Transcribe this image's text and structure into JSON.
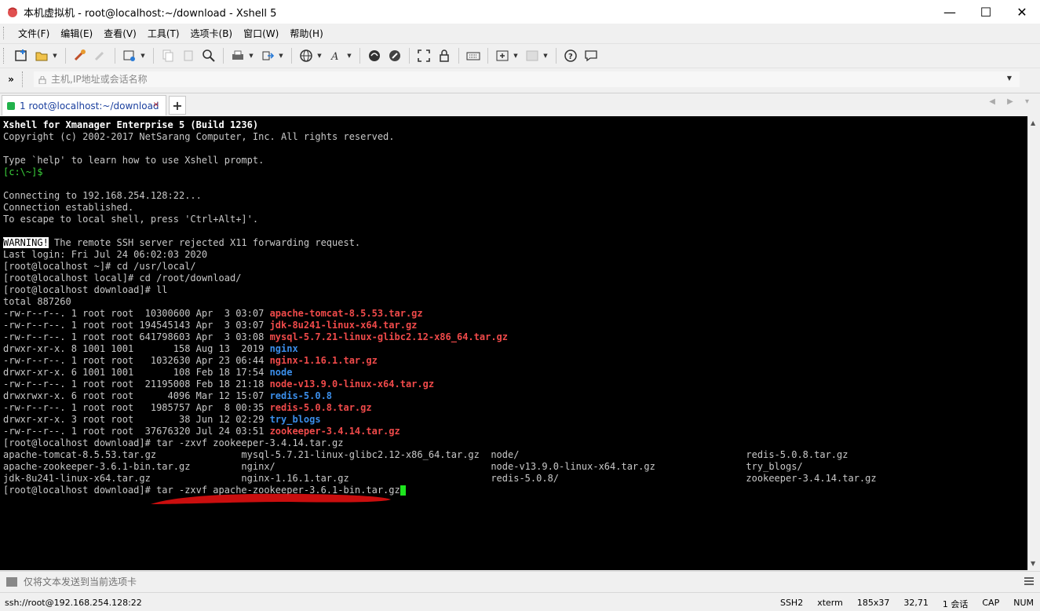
{
  "window": {
    "title": "本机虚拟机 - root@localhost:~/download - Xshell 5",
    "minimize": "—",
    "maximize": "☐",
    "close": "✕"
  },
  "menu": [
    "文件(F)",
    "编辑(E)",
    "查看(V)",
    "工具(T)",
    "选项卡(B)",
    "窗口(W)",
    "帮助(H)"
  ],
  "address": {
    "chevron": "»",
    "placeholder": "主机,IP地址或会话名称"
  },
  "tabs": {
    "active_label": "1 root@localhost:~/download",
    "close": "×",
    "add": "+",
    "nav": "◀ ▶ ▾"
  },
  "terminal": {
    "lines": [
      [
        {
          "t": "Xshell for Xmanager Enterprise 5 (Build 1236)",
          "c": "bold"
        }
      ],
      [
        {
          "t": "Copyright (c) 2002-2017 NetSarang Computer, Inc. All rights reserved.",
          "c": ""
        }
      ],
      [
        {
          "t": "",
          "c": ""
        }
      ],
      [
        {
          "t": "Type `help' to learn how to use Xshell prompt.",
          "c": ""
        }
      ],
      [
        {
          "t": "[c:\\~]$",
          "c": "green"
        }
      ],
      [
        {
          "t": "",
          "c": ""
        }
      ],
      [
        {
          "t": "Connecting to 192.168.254.128:22...",
          "c": ""
        }
      ],
      [
        {
          "t": "Connection established.",
          "c": ""
        }
      ],
      [
        {
          "t": "To escape to local shell, press 'Ctrl+Alt+]'.",
          "c": ""
        }
      ],
      [
        {
          "t": "",
          "c": ""
        }
      ],
      [
        {
          "t": "WARNING!",
          "c": "warn"
        },
        {
          "t": " The remote SSH server rejected X11 forwarding request.",
          "c": ""
        }
      ],
      [
        {
          "t": "Last login: Fri Jul 24 06:02:03 2020",
          "c": ""
        }
      ],
      [
        {
          "t": "[root@localhost ~]# cd /usr/local/",
          "c": ""
        }
      ],
      [
        {
          "t": "[root@localhost local]# cd /root/download/",
          "c": ""
        }
      ],
      [
        {
          "t": "[root@localhost download]# ll",
          "c": ""
        }
      ],
      [
        {
          "t": "total 887260",
          "c": ""
        }
      ],
      [
        {
          "t": "-rw-r--r--. 1 root root  10300600 Apr  3 03:07 ",
          "c": ""
        },
        {
          "t": "apache-tomcat-8.5.53.tar.gz",
          "c": "red"
        }
      ],
      [
        {
          "t": "-rw-r--r--. 1 root root 194545143 Apr  3 03:07 ",
          "c": ""
        },
        {
          "t": "jdk-8u241-linux-x64.tar.gz",
          "c": "red"
        }
      ],
      [
        {
          "t": "-rw-r--r--. 1 root root 641798603 Apr  3 03:08 ",
          "c": ""
        },
        {
          "t": "mysql-5.7.21-linux-glibc2.12-x86_64.tar.gz",
          "c": "red"
        }
      ],
      [
        {
          "t": "drwxr-xr-x. 8 1001 1001       158 Aug 13  2019 ",
          "c": ""
        },
        {
          "t": "nginx",
          "c": "blue"
        }
      ],
      [
        {
          "t": "-rw-r--r--. 1 root root   1032630 Apr 23 06:44 ",
          "c": ""
        },
        {
          "t": "nginx-1.16.1.tar.gz",
          "c": "red"
        }
      ],
      [
        {
          "t": "drwxr-xr-x. 6 1001 1001       108 Feb 18 17:54 ",
          "c": ""
        },
        {
          "t": "node",
          "c": "blue"
        }
      ],
      [
        {
          "t": "-rw-r--r--. 1 root root  21195008 Feb 18 21:18 ",
          "c": ""
        },
        {
          "t": "node-v13.9.0-linux-x64.tar.gz",
          "c": "red"
        }
      ],
      [
        {
          "t": "drwxrwxr-x. 6 root root      4096 Mar 12 15:07 ",
          "c": ""
        },
        {
          "t": "redis-5.0.8",
          "c": "blue"
        }
      ],
      [
        {
          "t": "-rw-r--r--. 1 root root   1985757 Apr  8 00:35 ",
          "c": ""
        },
        {
          "t": "redis-5.0.8.tar.gz",
          "c": "red"
        }
      ],
      [
        {
          "t": "drwxr-xr-x. 3 root root        38 Jun 12 02:29 ",
          "c": ""
        },
        {
          "t": "try_blogs",
          "c": "blue"
        }
      ],
      [
        {
          "t": "-rw-r--r--. 1 root root  37676320 Jul 24 03:51 ",
          "c": ""
        },
        {
          "t": "zookeeper-3.4.14.tar.gz",
          "c": "red"
        }
      ],
      [
        {
          "t": "[root@localhost download]# tar -zxvf zookeeper-3.4.14.tar.gz",
          "c": ""
        }
      ],
      [
        {
          "t": "apache-tomcat-8.5.53.tar.gz               mysql-5.7.21-linux-glibc2.12-x86_64.tar.gz  node/                                        redis-5.0.8.tar.gz",
          "c": ""
        }
      ],
      [
        {
          "t": "apache-zookeeper-3.6.1-bin.tar.gz         nginx/                                      node-v13.9.0-linux-x64.tar.gz                try_blogs/",
          "c": ""
        }
      ],
      [
        {
          "t": "jdk-8u241-linux-x64.tar.gz                nginx-1.16.1.tar.gz                         redis-5.0.8/                                 zookeeper-3.4.14.tar.gz",
          "c": ""
        }
      ],
      [
        {
          "t": "[root@localhost download]# tar -zxvf apache-zookeeper-3.6.1-bin.tar.gz",
          "c": ""
        },
        {
          "t": "",
          "c": "cursor"
        }
      ]
    ]
  },
  "compose": {
    "placeholder": "仅将文本发送到当前选项卡"
  },
  "status": {
    "connection": "ssh://root@192.168.254.128:22",
    "protocol": "SSH2",
    "term": "xterm",
    "size": "185x37",
    "position": "32,71",
    "sessions": "1 会话",
    "caps": "CAP",
    "num": "NUM"
  },
  "colors": {
    "terminal_bg": "#000000",
    "prompt_green": "#3bd13b",
    "archive_red": "#f04a4a",
    "dir_blue": "#3b8eea",
    "cursor_green": "#1ee51e",
    "annotation_red": "#e01010",
    "tab_dot": "#21b24b"
  }
}
